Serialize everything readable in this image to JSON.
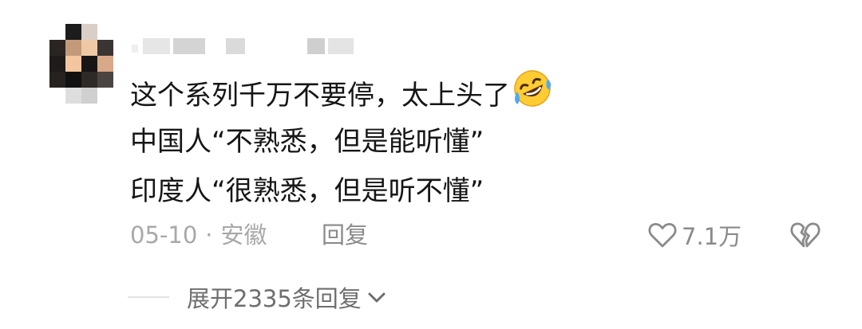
{
  "comment": {
    "lines": [
      "这个系列千万不要停，太上头了",
      "中国人“不熟悉，但是能听懂”",
      "印度人“很熟悉，但是听不懂”"
    ],
    "emoji_icon": "rolling-on-floor-laughing-emoji"
  },
  "meta": {
    "date": "05-10",
    "separator": "·",
    "location": "安徽",
    "reply_label": "回复"
  },
  "actions": {
    "like_count": "7.1万",
    "like_icon": "heart-outline-icon",
    "dislike_icon": "broken-heart-icon"
  },
  "replies": {
    "expand_label": "展开2335条回复",
    "expand_icon": "chevron-down-icon"
  },
  "colors": {
    "text_primary": "#161616",
    "text_meta": "#a8a8a8",
    "text_secondary": "#8a8a8a",
    "divider": "#e2e2e2"
  }
}
